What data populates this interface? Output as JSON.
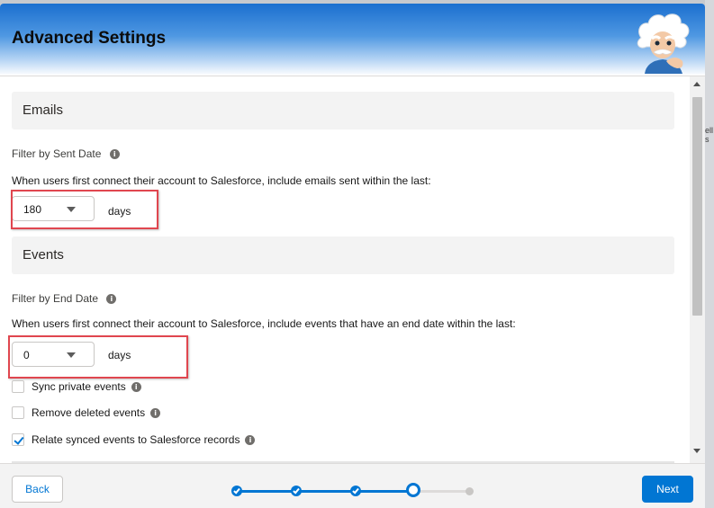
{
  "modal": {
    "title": "Advanced Settings"
  },
  "background": {
    "peek_text": "ell\ns"
  },
  "emails": {
    "section_title": "Emails",
    "filter_label": "Filter by Sent Date",
    "description": "When users first connect their account to Salesforce, include emails sent within the last:",
    "select_value": "180",
    "unit": "days"
  },
  "events": {
    "section_title": "Events",
    "filter_label": "Filter by End Date",
    "description": "When users first connect their account to Salesforce, include events that have an end date within the last:",
    "select_value": "0",
    "unit": "days",
    "checkboxes": [
      {
        "label": "Sync private events",
        "checked": false
      },
      {
        "label": "Remove deleted events",
        "checked": false
      },
      {
        "label": "Relate synced events to Salesforce records",
        "checked": true
      }
    ]
  },
  "footer": {
    "back_label": "Back",
    "next_label": "Next",
    "progress": {
      "total_steps": 5,
      "completed_steps": 3,
      "current_step": 4
    }
  },
  "icons": {
    "info": "info-icon",
    "caret": "chevron-down-icon",
    "check": "checkmark-icon",
    "mascot": "einstein-mascot"
  },
  "colors": {
    "brand": "#0176d3",
    "highlight": "#e0464f",
    "header_gradient_top": "#1b6fcf"
  }
}
